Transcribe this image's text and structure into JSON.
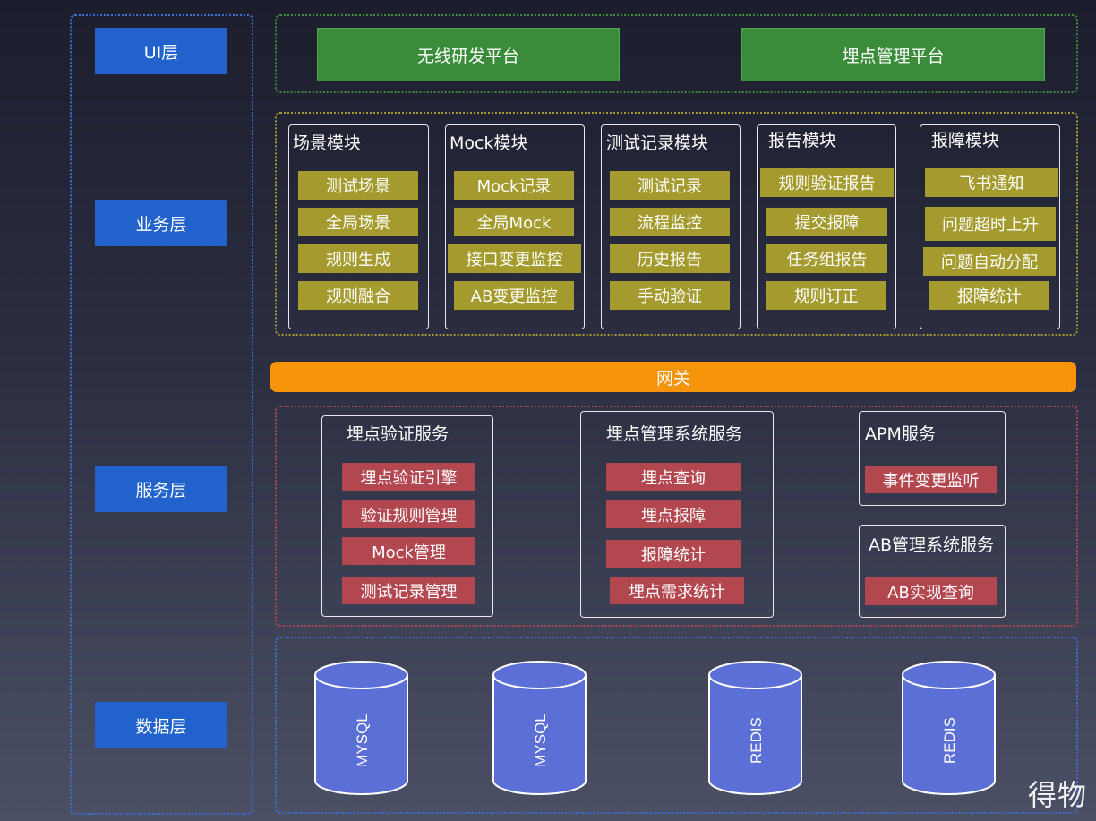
{
  "layers": {
    "ui": "UI层",
    "business": "业务层",
    "service": "服务层",
    "data": "数据层"
  },
  "ui_platforms": [
    "无线研发平台",
    "埋点管理平台"
  ],
  "business_modules": [
    {
      "title": "场景模块",
      "items": [
        "测试场景",
        "全局场景",
        "规则生成",
        "规则融合"
      ]
    },
    {
      "title": "Mock模块",
      "items": [
        "Mock记录",
        "全局Mock",
        "接口变更监控",
        "AB变更监控"
      ]
    },
    {
      "title": "测试记录模块",
      "items": [
        "测试记录",
        "流程监控",
        "历史报告",
        "手动验证"
      ]
    },
    {
      "title": "报告模块",
      "items": [
        "规则验证报告",
        "提交报障",
        "任务组报告",
        "规则订正"
      ]
    },
    {
      "title": "报障模块",
      "items": [
        "飞书通知",
        "问题超时上升",
        "问题自动分配",
        "报障统计"
      ]
    }
  ],
  "gateway": "网关",
  "services": [
    {
      "title": "埋点验证服务",
      "items": [
        "埋点验证引擎",
        "验证规则管理",
        "Mock管理",
        "测试记录管理"
      ]
    },
    {
      "title": "埋点管理系统服务",
      "items": [
        "埋点查询",
        "埋点报障",
        "报障统计",
        "埋点需求统计"
      ]
    },
    {
      "title": "APM服务",
      "items": [
        "事件变更监听"
      ]
    },
    {
      "title": "AB管理系统服务",
      "items": [
        "AB实现查询"
      ]
    }
  ],
  "databases": [
    "MYSQL",
    "MYSQL",
    "REDIS",
    "REDIS"
  ],
  "watermark": "得物",
  "colors": {
    "layer_label": "#2162cc",
    "ui_button": "#3b8c3a",
    "business_item": "#a49a2e",
    "service_item": "#b2474f",
    "gateway": "#f6940a",
    "database": "#5b6fd6"
  }
}
